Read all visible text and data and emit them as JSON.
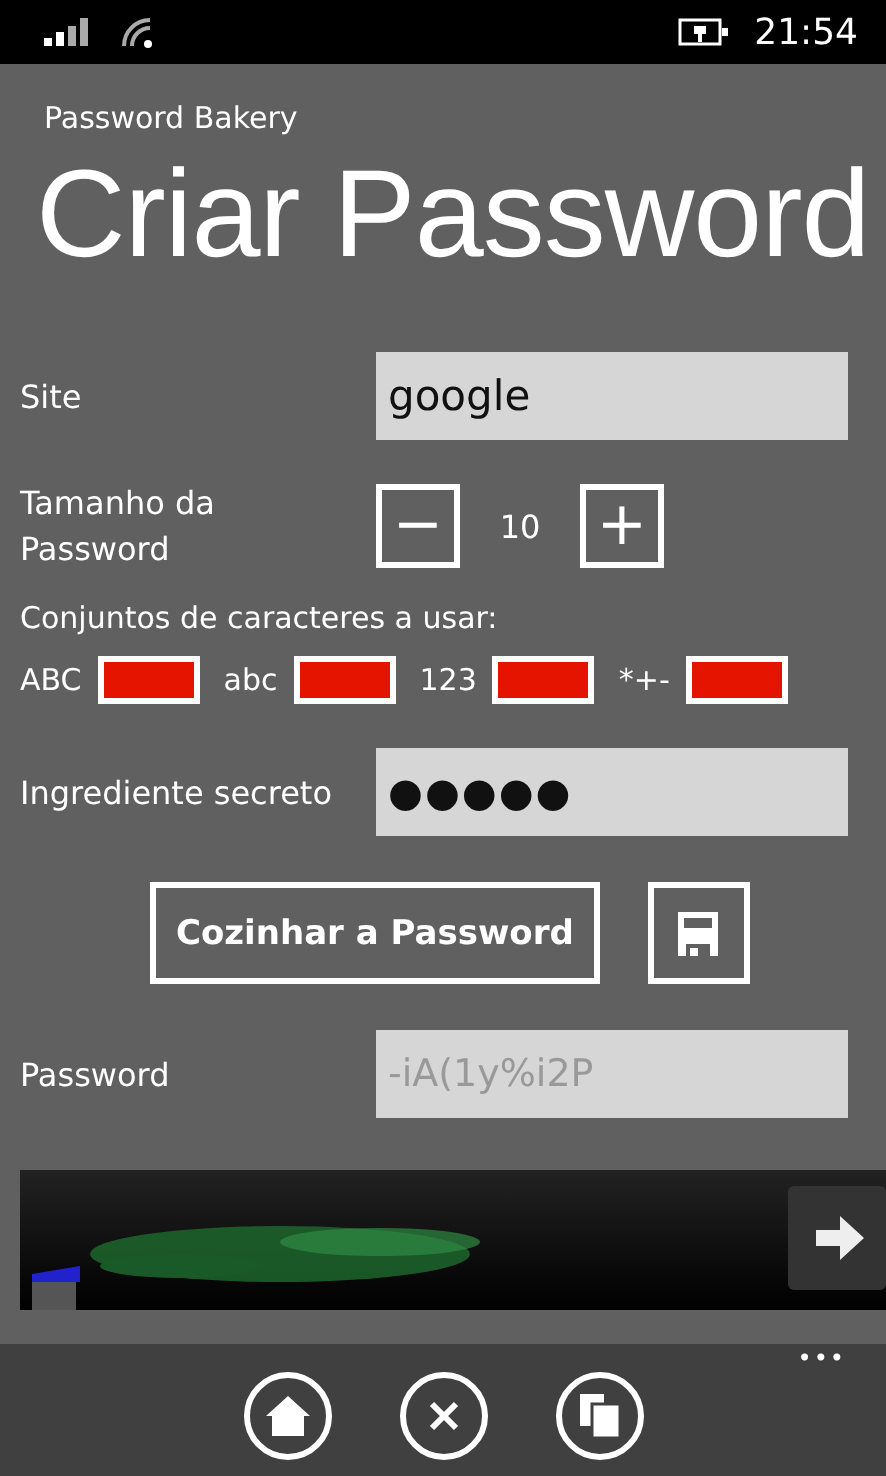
{
  "status_bar": {
    "time": "21:54"
  },
  "app_title": "Password Bakery",
  "page_title": "Criar Password",
  "site": {
    "label": "Site",
    "value": "google"
  },
  "length": {
    "label": "Tamanho da Password",
    "minus": "−",
    "value": "10",
    "plus": "+"
  },
  "charsets": {
    "label": "Conjuntos de caracteres a usar:",
    "items": [
      {
        "label": "ABC",
        "checked": true
      },
      {
        "label": "abc",
        "checked": true
      },
      {
        "label": "123",
        "checked": true
      },
      {
        "label": "*+-",
        "checked": true
      }
    ]
  },
  "secret": {
    "label": "Ingrediente secreto",
    "value": "●●●●●"
  },
  "bake_button": "Cozinhar a Password",
  "password": {
    "label": "Password",
    "value": "-iA(1y%i2P"
  },
  "app_bar": {
    "more": "•••"
  }
}
